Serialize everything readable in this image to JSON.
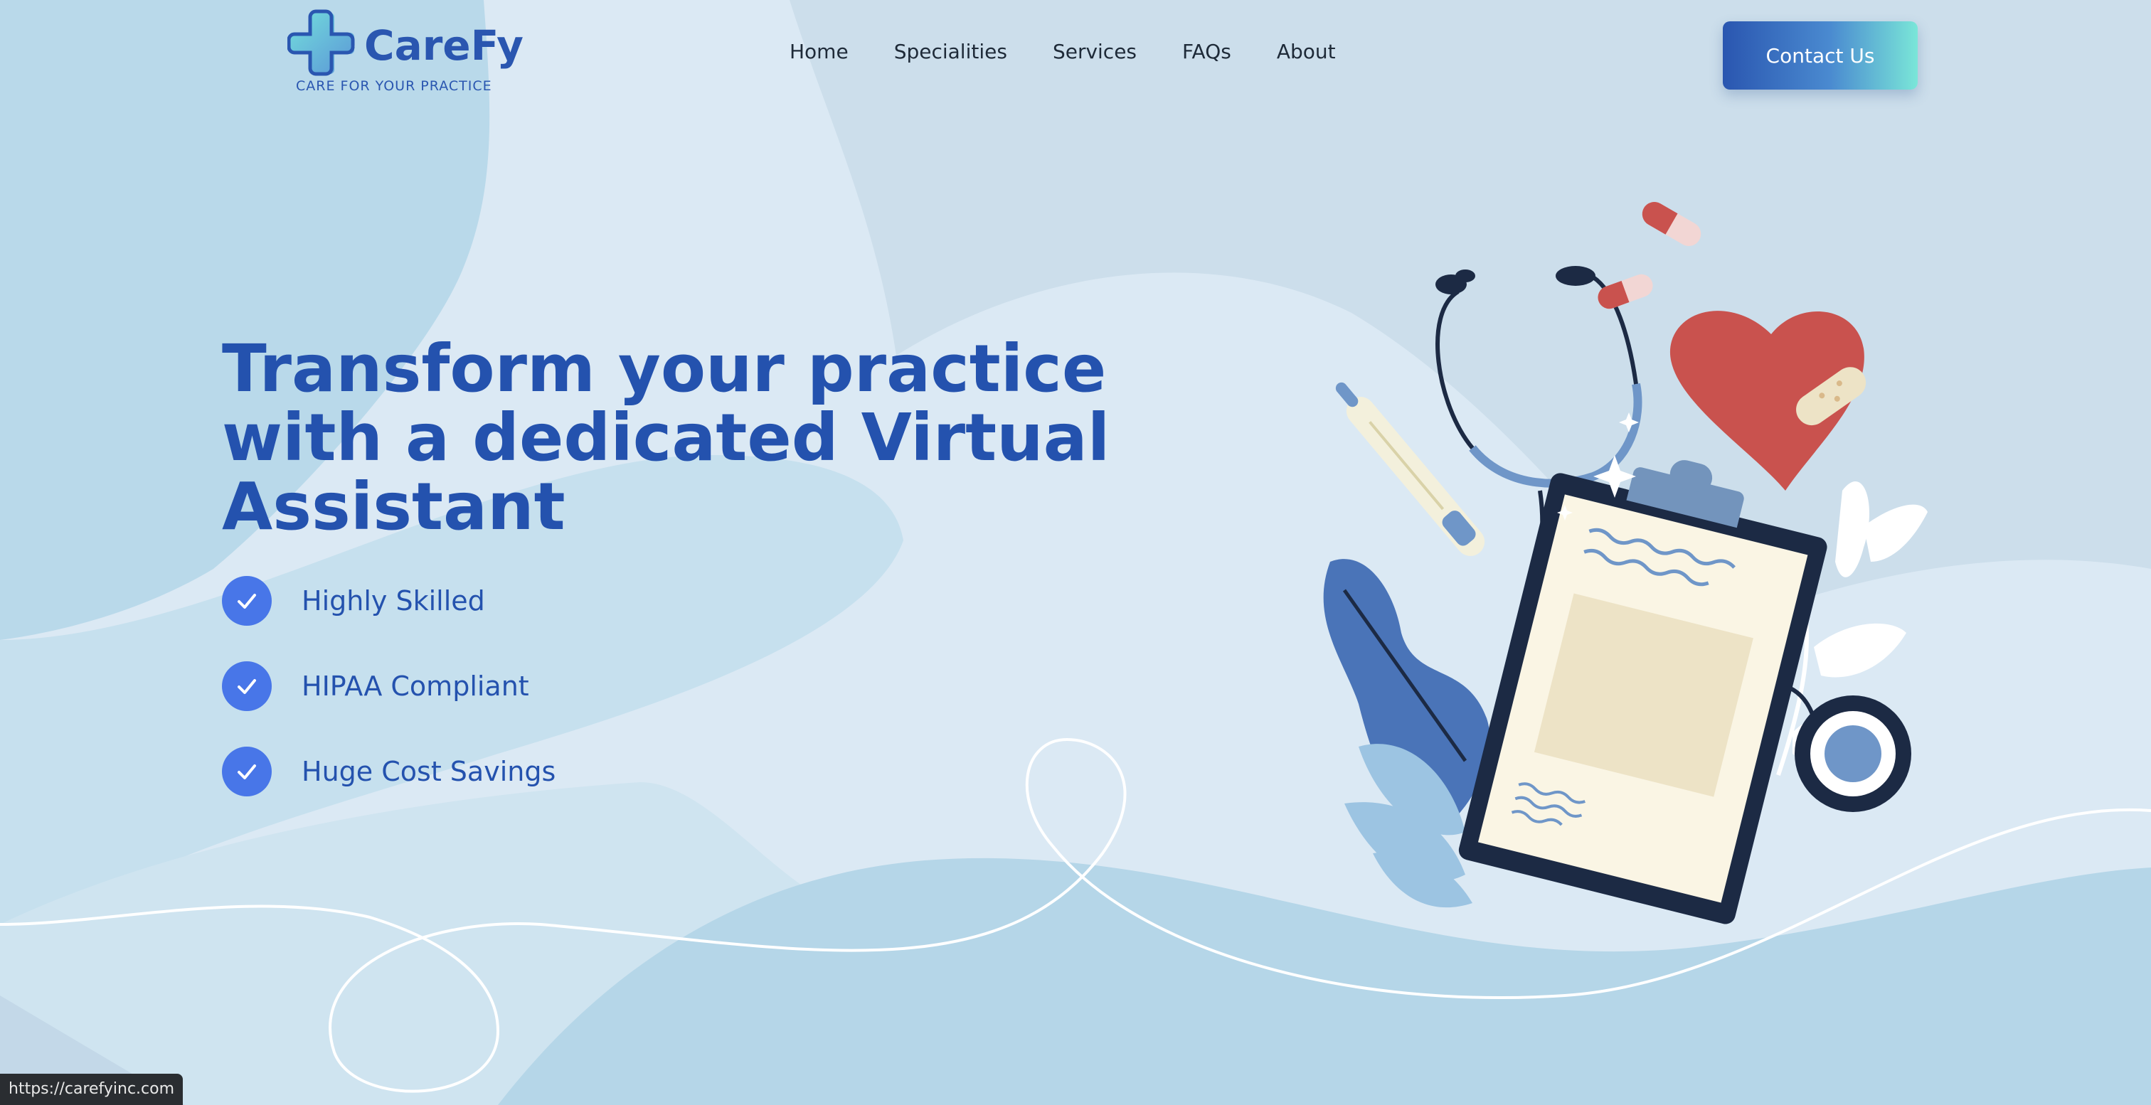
{
  "brand": {
    "name": "CareFy",
    "tagline": "CARE FOR YOUR PRACTICE",
    "colors": {
      "primary": "#2a56b0",
      "accent": "#7ae6d8",
      "check": "#4876e8"
    }
  },
  "nav": {
    "items": [
      {
        "label": "Home"
      },
      {
        "label": "Specialities"
      },
      {
        "label": "Services"
      },
      {
        "label": "FAQs"
      },
      {
        "label": "About"
      }
    ],
    "cta_label": "Contact Us"
  },
  "hero": {
    "title_lines": [
      "Transform your practice",
      "with a dedicated Virtual",
      "Assistant"
    ],
    "features": [
      {
        "label": "Highly Skilled",
        "icon": "check-icon"
      },
      {
        "label": "HIPAA Compliant",
        "icon": "check-icon"
      },
      {
        "label": "Huge Cost Savings",
        "icon": "check-icon"
      }
    ]
  },
  "illustration": {
    "icons": [
      "stethoscope-icon",
      "clipboard-icon",
      "heart-icon",
      "pill-icon",
      "thermometer-icon",
      "leaf-icon",
      "sparkle-icon"
    ]
  },
  "statusbar": {
    "url": "https://carefyinc.com"
  }
}
